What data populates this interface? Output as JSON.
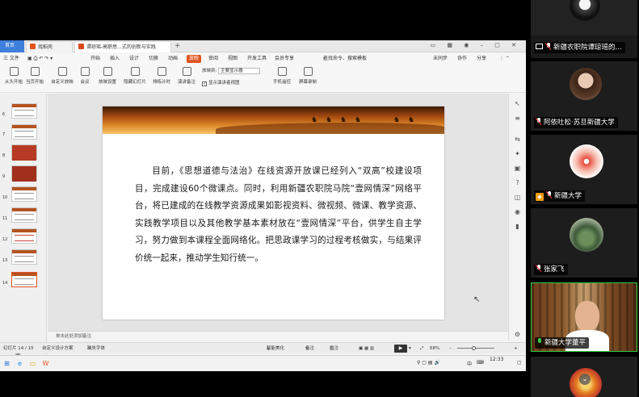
{
  "browser_tabs": [
    {
      "label": "首页"
    },
    {
      "label": "找稻壳"
    },
    {
      "label": "谭琼瑶-高职思...式的创新与实践"
    }
  ],
  "menu": {
    "file": "三 文件",
    "items": [
      "开始",
      "插入",
      "设计",
      "切换",
      "动画",
      "放映",
      "审阅",
      "视图",
      "开发工具",
      "会员专享"
    ],
    "active": "放映",
    "search": "查找命令、搜索模板",
    "right": [
      "未同步",
      "协作",
      "分享"
    ]
  },
  "ribbon": {
    "buttons": [
      "从头开始",
      "当页开始",
      "自定义放映",
      "会议",
      "放映设置",
      "隐藏幻灯片",
      "排练计时",
      "演讲备注",
      "手机遥控",
      "屏幕录制"
    ],
    "display_label": "放映到:",
    "display_value": "主要显示器",
    "presenter_view": "显示演讲者视图"
  },
  "thumbnails": {
    "numbers": [
      "6",
      "7",
      "8",
      "9",
      "10",
      "11",
      "12",
      "13",
      "14"
    ],
    "selected": "14"
  },
  "slide": {
    "body": "目前，《思想道德与法治》在线资源开放课已经列入“双高”校建设项目，完成建设60个微课点。同时，利用新疆农职院马院“壹网情深”网络平台，将已建成的在线教学资源成果如影视资料、微视频、微课、教学资源、实践教学项目以及其他教学基本素材放在“壹网情深”平台，供学生自主学习，努力做到本课程全面网络化。把思政课学习的过程考核做实，与结果评价统一起来，推动学生知行统一。"
  },
  "notes_placeholder": "单击此处添加备注",
  "status": {
    "slide_count": "幻灯片 14 / 15",
    "theme": "自定义设计方案",
    "font_missing": "缺失字体",
    "smart_beautify": "智能美化",
    "notes": "备注",
    "comments": "批注",
    "zoom": "68%"
  },
  "taskbar": {
    "time": "12:33",
    "ime": "中",
    "date": "2021/..."
  },
  "participants": [
    {
      "name": "新疆农职院谭琼瑶的...",
      "muted": true,
      "sharing": true
    },
    {
      "name": "阿依吐松·苏旦新疆大学",
      "muted": true
    },
    {
      "name": "新疆大学",
      "muted": true,
      "user_icon": true
    },
    {
      "name": "张家飞",
      "muted": true
    },
    {
      "name": "新疆大学董平",
      "muted": false,
      "speaking": true
    }
  ],
  "colors": {
    "accent": "#e2531f",
    "active_speaker": "#2ecc40",
    "muted": "#ff3b30",
    "home_tab": "#3f7fdc"
  }
}
